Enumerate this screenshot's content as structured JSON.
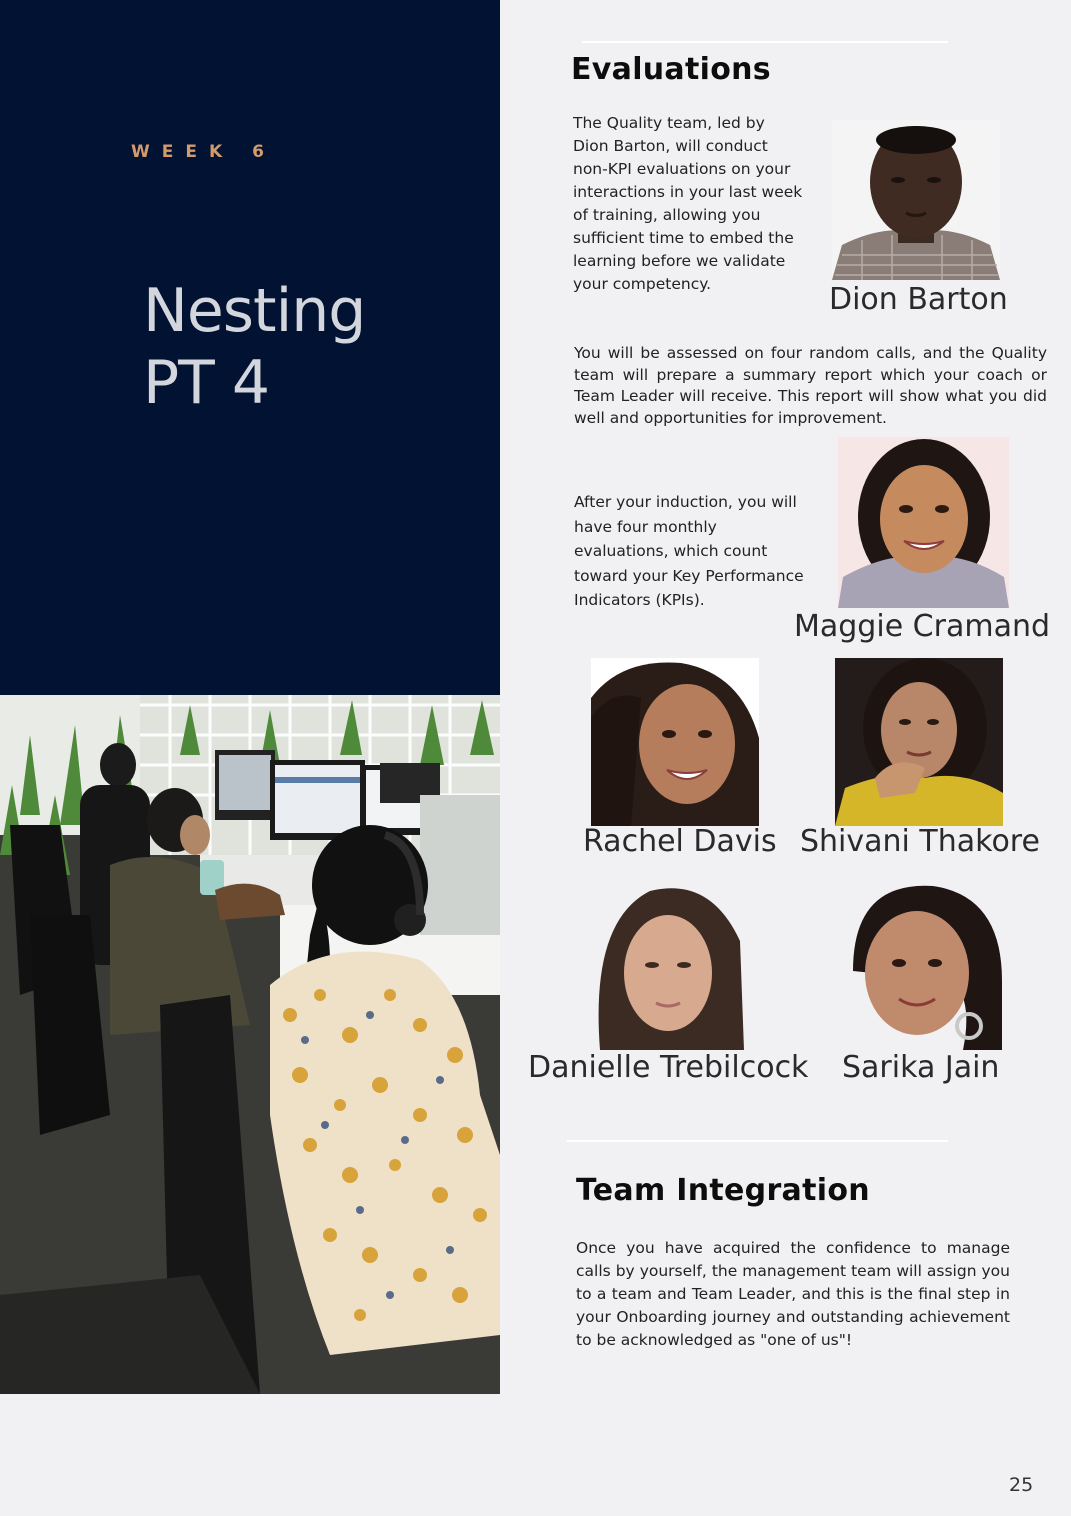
{
  "cover": {
    "week_label": "WEEK 6",
    "title_line1": "Nesting",
    "title_line2": "PT 4"
  },
  "evaluations": {
    "heading": "Evaluations",
    "intro": "The Quality team, led by Dion Barton,  will conduct non-KPI evaluations on your interactions in your last week of training, allowing you sufficient time to embed the learning before we validate your competency.",
    "assessment": "You will be assessed on four random calls, and the Quality team will prepare a summary report which your coach or Team Leader will receive. This report will show what you did well and opportunities for improvement.",
    "monthly": "After your induction, you will have four monthly evaluations, which count toward your Key Performance Indicators (KPIs)."
  },
  "people": {
    "dion": "Dion Barton",
    "maggie": "Maggie Cramand",
    "rachel": "Rachel Davis",
    "shivani": "Shivani Thakore",
    "danielle": "Danielle Trebilcock",
    "sarika": "Sarika Jain"
  },
  "team_integration": {
    "heading": "Team Integration",
    "body": "Once you have acquired the confidence to manage calls by yourself, the management team will assign you to a team and Team Leader, and this is the final step in your Onboarding journey and outstanding achievement to be acknowledged as \"one of us\"!"
  },
  "page_number": "25",
  "colors": {
    "navy": "#011232",
    "accent": "#d49a6a",
    "page_bg": "#f1f1f3"
  }
}
